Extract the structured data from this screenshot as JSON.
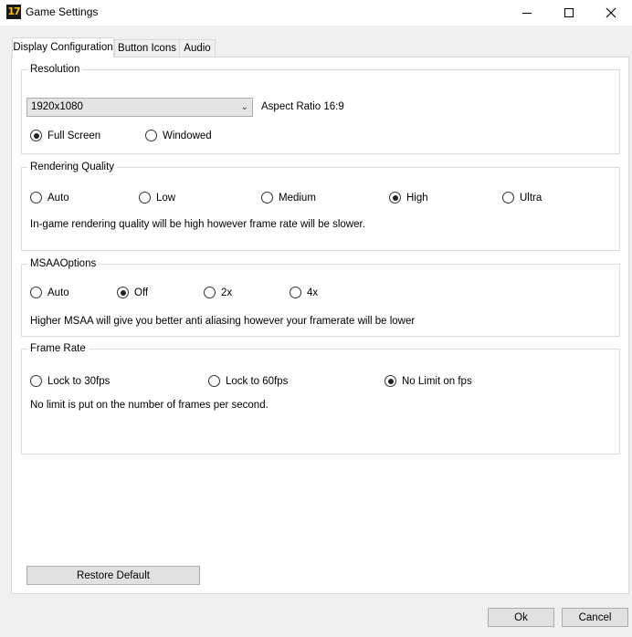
{
  "window": {
    "icon_text": "17",
    "title": "Game Settings"
  },
  "tabs": [
    {
      "label": "Display Configuration",
      "active": true
    },
    {
      "label": "Button Icons",
      "active": false
    },
    {
      "label": "Audio",
      "active": false
    }
  ],
  "resolution": {
    "title": "Resolution",
    "selected": "1920x1080",
    "aspect": "Aspect Ratio 16:9",
    "modes": [
      {
        "label": "Full Screen",
        "checked": true
      },
      {
        "label": "Windowed",
        "checked": false
      }
    ]
  },
  "rendering_quality": {
    "title": "Rendering Quality",
    "options": [
      {
        "label": "Auto",
        "checked": false
      },
      {
        "label": "Low",
        "checked": false
      },
      {
        "label": "Medium",
        "checked": false
      },
      {
        "label": "High",
        "checked": true
      },
      {
        "label": "Ultra",
        "checked": false
      }
    ],
    "description": "In-game rendering quality will be high however frame rate will be slower."
  },
  "msaa": {
    "title": "MSAAOptions",
    "options": [
      {
        "label": "Auto",
        "checked": false
      },
      {
        "label": "Off",
        "checked": true
      },
      {
        "label": "2x",
        "checked": false
      },
      {
        "label": "4x",
        "checked": false
      }
    ],
    "description": "Higher MSAA will give you better anti aliasing however your framerate will be lower"
  },
  "frame_rate": {
    "title": "Frame Rate",
    "options": [
      {
        "label": "Lock  to 30fps",
        "checked": false
      },
      {
        "label": "Lock to 60fps",
        "checked": false
      },
      {
        "label": "No Limit on fps",
        "checked": true
      }
    ],
    "description": "No limit is put on the number of frames per second."
  },
  "buttons": {
    "restore": "Restore Default",
    "ok": "Ok",
    "cancel": "Cancel"
  }
}
